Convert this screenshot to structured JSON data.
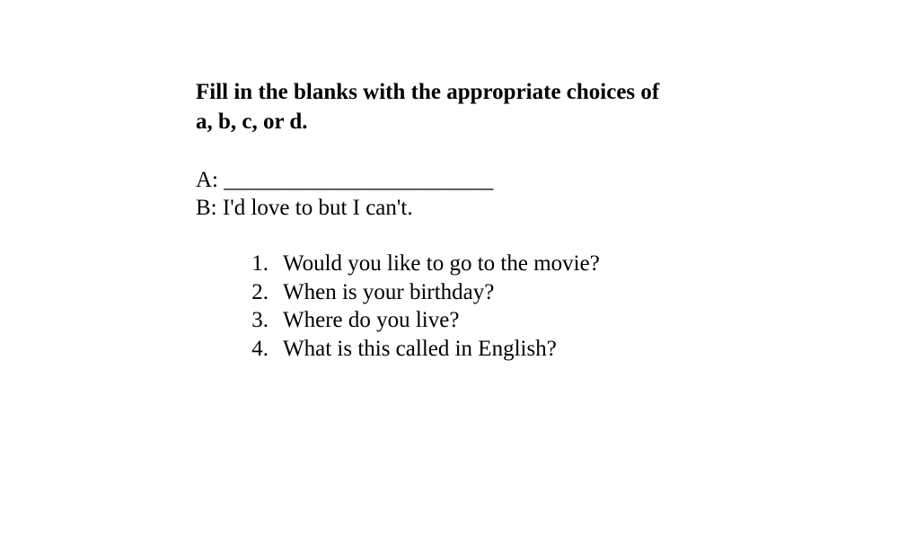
{
  "instructions": {
    "line1": "Fill in the blanks with the appropriate choices of",
    "line2": "a, b, c, or d."
  },
  "dialogue": {
    "a_line": "A: ________________________",
    "b_line": "B: I'd love to but I can't."
  },
  "choices": [
    {
      "number": "1.",
      "text": "Would you like to go to the movie?"
    },
    {
      "number": "2.",
      "text": "When is your birthday?"
    },
    {
      "number": "3.",
      "text": "Where do you live?"
    },
    {
      "number": "4.",
      "text": "What is this called in English?"
    }
  ]
}
